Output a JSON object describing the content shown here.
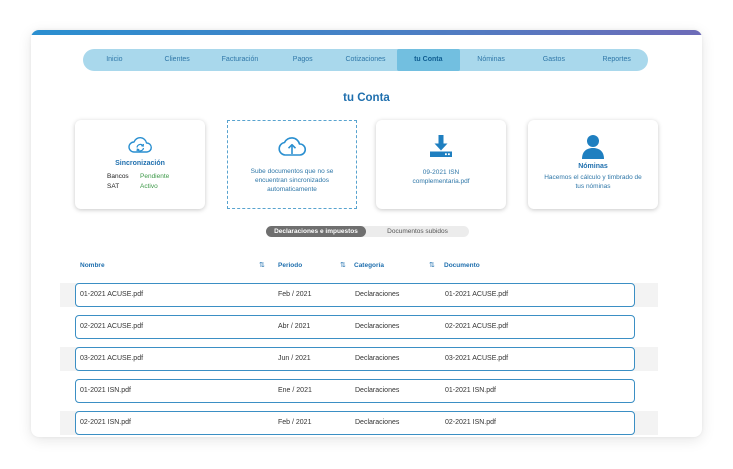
{
  "colors": {
    "accent": "#1f6fae",
    "nav_bg": "#a9d8ec",
    "nav_active": "#72bfe0",
    "status_green": "#3f9a4a",
    "row_border": "#3b8fc4"
  },
  "nav": {
    "items": [
      {
        "label": "Inicio"
      },
      {
        "label": "Clientes"
      },
      {
        "label": "Facturación"
      },
      {
        "label": "Pagos"
      },
      {
        "label": "Cotizaciones"
      },
      {
        "label": "tu Conta",
        "active": true
      },
      {
        "label": "Nóminas"
      },
      {
        "label": "Gastos"
      },
      {
        "label": "Reportes"
      }
    ]
  },
  "page": {
    "title": "tu Conta"
  },
  "cards": {
    "sync": {
      "icon": "cloud-sync-icon",
      "title": "Sincronización",
      "rows": [
        {
          "key": "Bancos",
          "value": "Pendiente"
        },
        {
          "key": "SAT",
          "value": "Activo"
        }
      ]
    },
    "upload": {
      "icon": "cloud-upload-icon",
      "text": "Sube documentos que no se encuentran sincronizados automaticamente"
    },
    "isn": {
      "icon": "download-icon",
      "text": "09-2021 ISN complementaria.pdf"
    },
    "payroll": {
      "icon": "user-icon",
      "title": "Nóminas",
      "text": "Hacemos el cálculo y timbrado de tus nóminas"
    }
  },
  "toggle": {
    "selected": "Declaraciones e impuestos",
    "other": "Documentos subidos"
  },
  "table": {
    "columns": [
      "Nombre",
      "Periodo",
      "Categoría",
      "Documento"
    ],
    "rows": [
      [
        "01-2021 ACUSE.pdf",
        "Feb / 2021",
        "Declaraciones",
        "01-2021 ACUSE.pdf"
      ],
      [
        "02-2021 ACUSE.pdf",
        "Abr / 2021",
        "Declaraciones",
        "02-2021 ACUSE.pdf"
      ],
      [
        "03-2021 ACUSE.pdf",
        "Jun / 2021",
        "Declaraciones",
        "03-2021 ACUSE.pdf"
      ],
      [
        "01-2021 ISN.pdf",
        "Ene / 2021",
        "Declaraciones",
        "01-2021 ISN.pdf"
      ],
      [
        "02-2021 ISN.pdf",
        "Feb / 2021",
        "Declaraciones",
        "02-2021 ISN.pdf"
      ]
    ]
  }
}
